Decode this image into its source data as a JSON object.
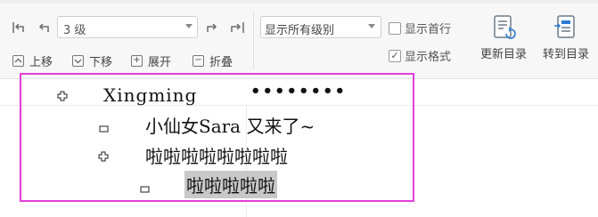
{
  "toolbar": {
    "level_select": {
      "value": "3 级"
    },
    "move_up_label": "上移",
    "move_down_label": "下移",
    "expand_label": "展开",
    "collapse_label": "折叠",
    "show_levels_select": {
      "value": "显示所有级别"
    },
    "show_first_line_label": "显示首行",
    "show_first_line_checked": false,
    "show_format_label": "显示格式",
    "show_format_checked": true,
    "update_toc_label": "更新目录",
    "goto_toc_label": "转到目录"
  },
  "outline": {
    "items": [
      {
        "level": 1,
        "marker": "plus",
        "text": "Xingming",
        "extra": "••••••••"
      },
      {
        "level": 2,
        "marker": "minus",
        "text": "小仙女Sara 又来了~"
      },
      {
        "level": 2,
        "marker": "plus",
        "text": "啦啦啦啦啦啦啦啦"
      },
      {
        "level": 3,
        "marker": "minus",
        "text": "啦啦啦啦啦",
        "selected": true
      }
    ]
  },
  "colors": {
    "highlight_frame": "#e23ddb",
    "selection": "#c8c8c8"
  }
}
